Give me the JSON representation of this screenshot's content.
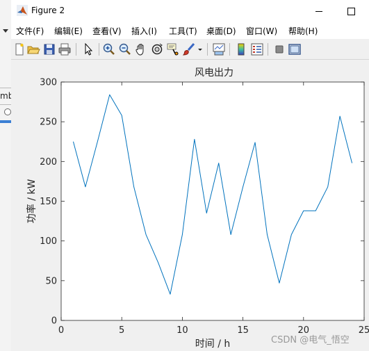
{
  "window": {
    "title": "Figure 2",
    "background_app_text": "mb"
  },
  "menu": {
    "items": [
      {
        "label": "文件(F)"
      },
      {
        "label": "编辑(E)"
      },
      {
        "label": "查看(V)"
      },
      {
        "label": "插入(I)"
      },
      {
        "label": "工具(T)"
      },
      {
        "label": "桌面(D)"
      },
      {
        "label": "窗口(W)"
      },
      {
        "label": "帮助(H)"
      }
    ]
  },
  "toolbar": {
    "icons": [
      "new-figure-icon",
      "open-file-icon",
      "save-icon",
      "print-icon",
      "edit-plot-arrow-icon",
      "zoom-in-icon",
      "zoom-out-icon",
      "pan-hand-icon",
      "rotate-3d-icon",
      "data-cursor-icon",
      "brush-icon",
      "brush-dropdown-icon",
      "link-plot-icon",
      "insert-colorbar-icon",
      "insert-legend-icon",
      "hide-plot-tools-icon",
      "show-plot-tools-icon"
    ]
  },
  "chart_data": {
    "type": "line",
    "title": "风电出力",
    "xlabel": "时间 / h",
    "ylabel": "功率 / kW",
    "xlim": [
      0,
      25
    ],
    "ylim": [
      0,
      300
    ],
    "xticks": [
      0,
      5,
      10,
      15,
      20,
      25
    ],
    "yticks": [
      0,
      50,
      100,
      150,
      200,
      250,
      300
    ],
    "grid": false,
    "series": [
      {
        "color": "#0072bd",
        "x": [
          1,
          2,
          3,
          4,
          5,
          6,
          7,
          8,
          9,
          10,
          11,
          12,
          13,
          14,
          15,
          16,
          17,
          18,
          19,
          20,
          21,
          22,
          23,
          24
        ],
        "values": [
          225,
          168,
          225,
          284,
          258,
          168,
          108,
          73,
          33,
          108,
          228,
          135,
          198,
          108,
          168,
          224,
          108,
          47,
          108,
          138,
          138,
          168,
          257,
          198
        ]
      }
    ]
  },
  "watermark": "CSDN @电气_悟空"
}
